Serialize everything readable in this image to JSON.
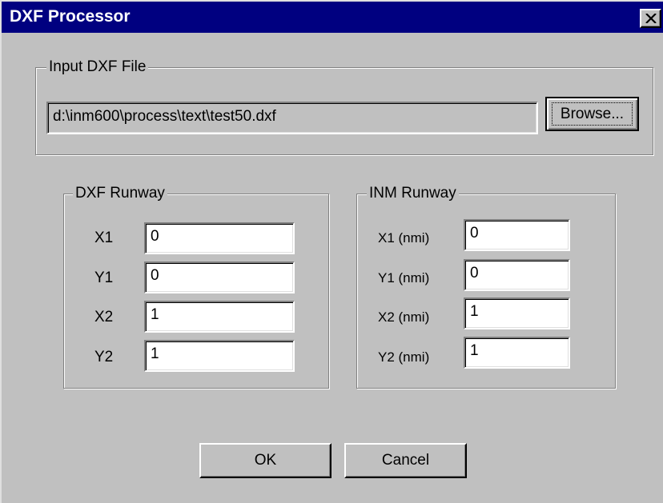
{
  "window": {
    "title": "DXF Processor"
  },
  "input_group": {
    "label": "Input DXF File",
    "path_value": "d:\\inm600\\process\\text\\test50.dxf",
    "browse_label": "Browse..."
  },
  "dxf_runway": {
    "label": "DXF Runway",
    "rows": [
      {
        "label": "X1",
        "value": "0"
      },
      {
        "label": "Y1",
        "value": "0"
      },
      {
        "label": "X2",
        "value": "1"
      },
      {
        "label": "Y2",
        "value": "1"
      }
    ]
  },
  "inm_runway": {
    "label": "INM Runway",
    "rows": [
      {
        "label": "X1 (nmi)",
        "value": "0"
      },
      {
        "label": "Y1 (nmi)",
        "value": "0"
      },
      {
        "label": "X2 (nmi)",
        "value": "1"
      },
      {
        "label": "Y2 (nmi)",
        "value": "1"
      }
    ]
  },
  "buttons": {
    "ok_label": "OK",
    "cancel_label": "Cancel"
  },
  "icons": {
    "close": "close-icon"
  },
  "colors": {
    "titlebar": "#000080",
    "face": "#c0c0c0"
  }
}
